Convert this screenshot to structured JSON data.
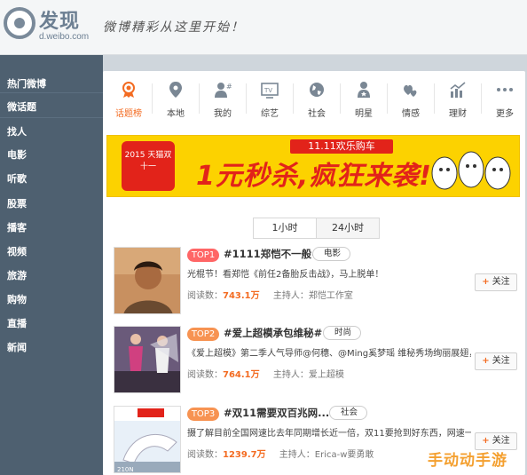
{
  "header": {
    "logo_title": "发现",
    "logo_sub": "d.weibo.com",
    "slogan": "微博精彩从这里开始！"
  },
  "sidebar": {
    "items": [
      "热门微博",
      "微话题",
      "找人",
      "电影",
      "听歌",
      "股票",
      "播客",
      "视频",
      "旅游",
      "购物",
      "直播",
      "新闻"
    ]
  },
  "categories": [
    {
      "label": "话题榜",
      "icon": "ribbon-medal-icon"
    },
    {
      "label": "本地",
      "icon": "location-pin-icon"
    },
    {
      "label": "我的",
      "icon": "person-hash-icon"
    },
    {
      "label": "综艺",
      "icon": "tv-icon"
    },
    {
      "label": "社会",
      "icon": "globe-icon"
    },
    {
      "label": "明星",
      "icon": "star-person-icon"
    },
    {
      "label": "情感",
      "icon": "hearts-icon"
    },
    {
      "label": "理财",
      "icon": "chart-icon"
    },
    {
      "label": "更多",
      "icon": "more-dots-icon"
    }
  ],
  "banner": {
    "badge": "2015 天猫双十一",
    "top": "11.11欢乐购车",
    "main": "1元秒杀,疯狂来袭!"
  },
  "tabs": [
    "1小时",
    "24小时"
  ],
  "topics": [
    {
      "rank": "TOP1",
      "title": "#1111郑恺不一般#",
      "tag": "电影",
      "desc": "光棍节！看郑恺《前任2备胎反击战》，马上脱单！",
      "reads_label": "阅读数：",
      "reads": "743.1万",
      "host_label": "主持人：",
      "host": "郑恺工作室",
      "follow": "关注"
    },
    {
      "rank": "TOP2",
      "title": "#爱上超模承包维秘#",
      "tag": "时尚",
      "desc": "《爱上超模》第二季人气导师@何穗、@Ming奚梦瑶 维秘秀场绚丽展翅，",
      "reads_label": "阅读数：",
      "reads": "764.1万",
      "host_label": "主持人：",
      "host": "爱上超模",
      "follow": "关注"
    },
    {
      "rank": "TOP3",
      "title": "#双11需要双百兆网...",
      "tag": "社会",
      "desc": "摄了解目前全国网速比去年同期增长近一倍，双11要抢到好东西，网速一...",
      "reads_label": "阅读数：",
      "reads": "1239.7万",
      "host_label": "主持人：",
      "host": "Erica-w要勇敢",
      "follow": "关注"
    }
  ],
  "watermark": "手动动手游",
  "colors": {
    "sidebar": "#4e6070",
    "accent": "#f36b21",
    "banner": "#fcd200",
    "banner_red": "#e2231a"
  }
}
